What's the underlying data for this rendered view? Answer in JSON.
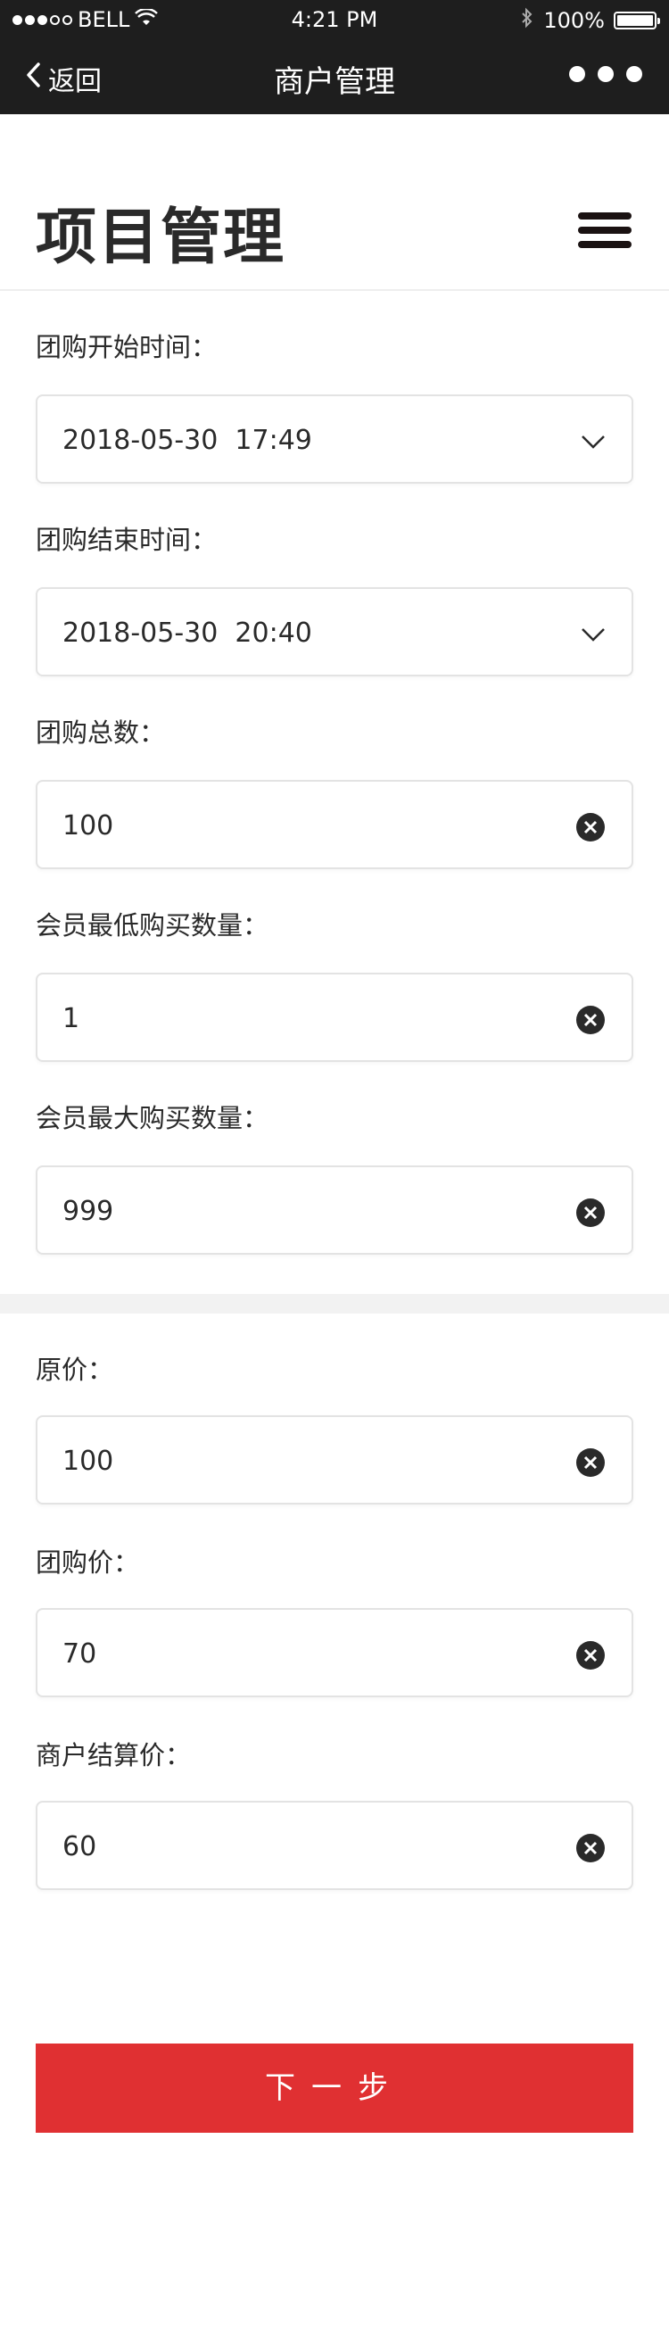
{
  "status_bar": {
    "carrier": "BELL",
    "time": "4:21 PM",
    "battery": "100%",
    "battery_level": 1.0,
    "icons": [
      "signal-dots",
      "wifi-icon",
      "bluetooth-icon",
      "battery-icon"
    ]
  },
  "nav": {
    "back_label": "返回",
    "title": "商户管理",
    "more_icon": "more-dots-icon"
  },
  "page": {
    "title": "项目管理",
    "menu_icon": "hamburger-icon"
  },
  "form": {
    "fields": [
      {
        "label": "团购开始时间：",
        "value": "2018-05-30  17:49",
        "kind": "select"
      },
      {
        "label": "团购结束时间：",
        "value": "2018-05-30  20:40",
        "kind": "select"
      },
      {
        "label": "团购总数：",
        "value": "100",
        "kind": "input"
      },
      {
        "label": "会员最低购买数量：",
        "value": "1",
        "kind": "input"
      },
      {
        "label": "会员最大购买数量：",
        "value": "999",
        "kind": "input"
      },
      {
        "label": "原价：",
        "value": "100",
        "kind": "input"
      },
      {
        "label": "团购价：",
        "value": "70",
        "kind": "input"
      },
      {
        "label": "商户结算价：",
        "value": "60",
        "kind": "input"
      }
    ]
  },
  "actions": {
    "next_label": "下一步"
  },
  "colors": {
    "topbar": "#1e1e1e",
    "accent": "#e03032",
    "divider": "#f2f2f2"
  }
}
